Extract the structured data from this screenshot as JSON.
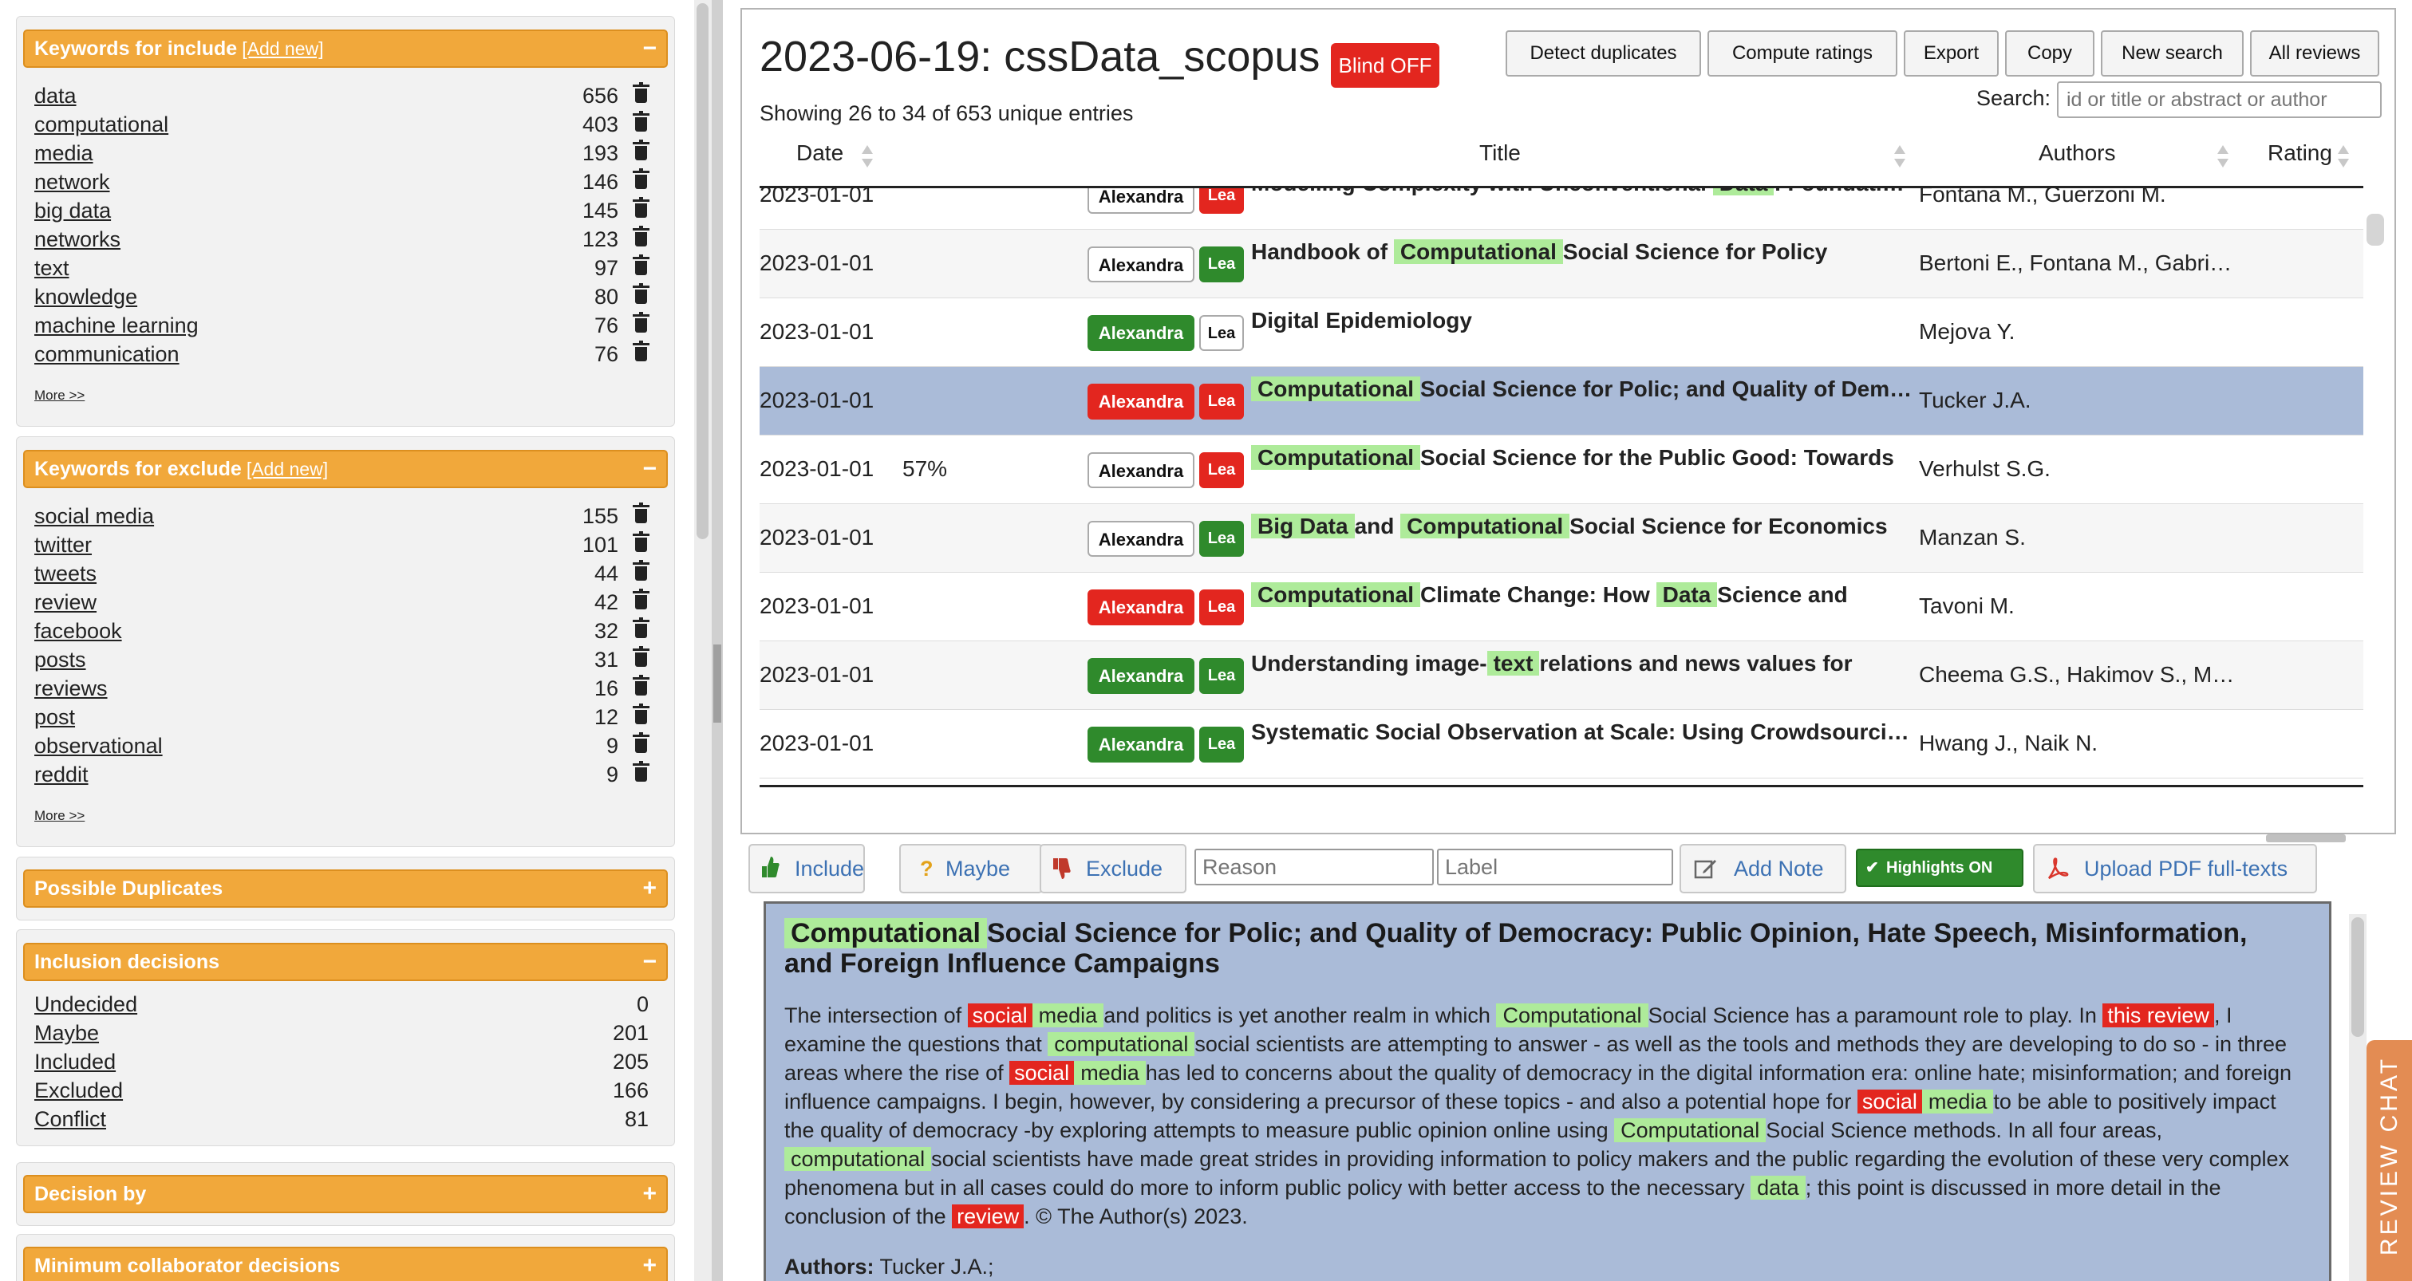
{
  "include_panel": {
    "title": "Keywords for include",
    "add_label": "[Add new]",
    "toggle": "−",
    "more": "More >>",
    "items": [
      {
        "k": "data",
        "n": "656"
      },
      {
        "k": "computational",
        "n": "403"
      },
      {
        "k": "media",
        "n": "193"
      },
      {
        "k": "network",
        "n": "146"
      },
      {
        "k": "big data",
        "n": "145"
      },
      {
        "k": "networks",
        "n": "123"
      },
      {
        "k": "text",
        "n": "97"
      },
      {
        "k": "knowledge",
        "n": "80"
      },
      {
        "k": "machine learning",
        "n": "76"
      },
      {
        "k": "communication",
        "n": "76"
      }
    ]
  },
  "exclude_panel": {
    "title": "Keywords for exclude",
    "add_label": "[Add new]",
    "toggle": "−",
    "more": "More >>",
    "items": [
      {
        "k": "social media",
        "n": "155"
      },
      {
        "k": "twitter",
        "n": "101"
      },
      {
        "k": "tweets",
        "n": "44"
      },
      {
        "k": "review",
        "n": "42"
      },
      {
        "k": "facebook",
        "n": "32"
      },
      {
        "k": "posts",
        "n": "31"
      },
      {
        "k": "reviews",
        "n": "16"
      },
      {
        "k": "post",
        "n": "12"
      },
      {
        "k": "observational",
        "n": "9"
      },
      {
        "k": "reddit",
        "n": "9"
      }
    ]
  },
  "duplicates_panel": {
    "title": "Possible Duplicates",
    "toggle": "+"
  },
  "decisions_panel": {
    "title": "Inclusion decisions",
    "toggle": "−",
    "items": [
      {
        "k": "Undecided",
        "n": "0"
      },
      {
        "k": "Maybe",
        "n": "201"
      },
      {
        "k": "Included",
        "n": "205"
      },
      {
        "k": "Excluded",
        "n": "166"
      },
      {
        "k": "Conflict",
        "n": "81"
      }
    ]
  },
  "decision_by_panel": {
    "title": "Decision by",
    "toggle": "+"
  },
  "min_collab_panel": {
    "title": "Minimum collaborator decisions",
    "toggle": "+"
  },
  "header": {
    "title": "2023-06-19: cssData_scopus",
    "blind": "Blind OFF",
    "showing": "Showing 26 to 34 of 653 unique entries",
    "search_label": "Search:",
    "search_placeholder": "id or title or abstract or author"
  },
  "toolbar": [
    "Detect duplicates",
    "Compute ratings",
    "Export",
    "Copy",
    "New search",
    "All reviews"
  ],
  "columns": {
    "date": "Date",
    "title": "Title",
    "authors": "Authors",
    "rating": "Rating"
  },
  "rows": [
    {
      "date": "2023-01-01",
      "pct": "",
      "r1": "Alexandra",
      "r1s": "w",
      "r2": "Lea",
      "r2s": "r",
      "title": [
        [
          "",
          "Modelling Complexity with Unconventional "
        ],
        [
          "g",
          "Data"
        ],
        [
          "",
          ": Foundations and Methods"
        ]
      ],
      "authors": "Fontana M., Guerzoni M."
    },
    {
      "date": "2023-01-01",
      "pct": "",
      "r1": "Alexandra",
      "r1s": "w",
      "r2": "Lea",
      "r2s": "g",
      "title": [
        [
          "",
          "Handbook of "
        ],
        [
          "g",
          "Computational"
        ],
        [
          "",
          "Social Science for Policy"
        ]
      ],
      "authors": "Bertoni E., Fontana M., Gabri…"
    },
    {
      "date": "2023-01-01",
      "pct": "",
      "r1": "Alexandra",
      "r1s": "g",
      "r2": "Lea",
      "r2s": "w",
      "title": [
        [
          "",
          "Digital Epidemiology"
        ]
      ],
      "authors": "Mejova Y."
    },
    {
      "date": "2023-01-01",
      "pct": "",
      "r1": "Alexandra",
      "r1s": "r",
      "r2": "Lea",
      "r2s": "r",
      "title": [
        [
          "g",
          "Computational"
        ],
        [
          "",
          "Social Science for Polic; and Quality of Democracy"
        ]
      ],
      "authors": "Tucker J.A.",
      "selected": true
    },
    {
      "date": "2023-01-01",
      "pct": "57%",
      "r1": "Alexandra",
      "r1s": "w",
      "r2": "Lea",
      "r2s": "r",
      "title": [
        [
          "g",
          "Computational"
        ],
        [
          "",
          "Social Science for the Public Good: Towards"
        ]
      ],
      "authors": "Verhulst S.G."
    },
    {
      "date": "2023-01-01",
      "pct": "",
      "r1": "Alexandra",
      "r1s": "w",
      "r2": "Lea",
      "r2s": "g",
      "title": [
        [
          "g",
          "Big Data"
        ],
        [
          "",
          "and "
        ],
        [
          "g",
          "Computational"
        ],
        [
          "",
          "Social Science for Economics"
        ]
      ],
      "authors": "Manzan S."
    },
    {
      "date": "2023-01-01",
      "pct": "",
      "r1": "Alexandra",
      "r1s": "r",
      "r2": "Lea",
      "r2s": "r",
      "title": [
        [
          "g",
          "Computational"
        ],
        [
          "",
          "Climate Change: How "
        ],
        [
          "g",
          "Data"
        ],
        [
          "",
          "Science and"
        ]
      ],
      "authors": "Tavoni M."
    },
    {
      "date": "2023-01-01",
      "pct": "",
      "r1": "Alexandra",
      "r1s": "g",
      "r2": "Lea",
      "r2s": "g",
      "title": [
        [
          "",
          "Understanding image-"
        ],
        [
          "g",
          "text"
        ],
        [
          "",
          "relations and news values for"
        ]
      ],
      "authors": "Cheema G.S., Hakimov S., M…"
    },
    {
      "date": "2023-01-01",
      "pct": "",
      "r1": "Alexandra",
      "r1s": "g",
      "r2": "Lea",
      "r2s": "g",
      "title": [
        [
          "",
          "Systematic Social Observation at Scale: Using Crowdsourcing"
        ]
      ],
      "authors": "Hwang J., Naik N."
    }
  ],
  "actions": {
    "include": "Include",
    "maybe": "Maybe",
    "exclude": "Exclude",
    "reason_ph": "Reason",
    "label_ph": "Label",
    "add_note": "Add Note",
    "highlights": "Highlights ON",
    "upload": "Upload PDF full-texts"
  },
  "detail": {
    "title": [
      [
        "g",
        "Computational"
      ],
      [
        "",
        "Social Science for Polic; and Quality of Democracy: Public Opinion, Hate Speech, Misinformation, and Foreign Influence Campaigns"
      ]
    ],
    "abstract": [
      [
        "",
        "The intersection of "
      ],
      [
        "r",
        "social"
      ],
      [
        "g",
        "media"
      ],
      [
        "",
        "and politics is yet another realm in which "
      ],
      [
        "g",
        "Computational"
      ],
      [
        "",
        "Social Science has a paramount role to play. In "
      ],
      [
        "r",
        "this review"
      ],
      [
        "",
        ", I examine the questions that "
      ],
      [
        "g",
        "computational"
      ],
      [
        "",
        "social scientists are attempting to answer - as well as the tools and methods they are developing to do so - in three areas where the rise of "
      ],
      [
        "r",
        "social"
      ],
      [
        "g",
        "media"
      ],
      [
        "",
        "has led to concerns about the quality of democracy in the digital information era: online hate; misinformation; and foreign influence campaigns. I begin, however, by considering a precursor of these topics - and also a potential hope for "
      ],
      [
        "r",
        "social"
      ],
      [
        "g",
        "media"
      ],
      [
        "",
        "to be able to positively impact the quality of democracy -by exploring attempts to measure public opinion online using "
      ],
      [
        "g",
        "Computational"
      ],
      [
        "",
        "Social Science methods. In all four areas, "
      ],
      [
        "g",
        "computational"
      ],
      [
        "",
        "social scientists have made great strides in providing information to policy makers and the public regarding the evolution of these very complex phenomena but in all cases could do more to inform public policy with better access to the necessary "
      ],
      [
        "g",
        "data"
      ],
      [
        "",
        "; this point is discussed in more detail in the conclusion of the "
      ],
      [
        "r",
        "review"
      ],
      [
        "",
        ". © The Author(s) 2023."
      ]
    ],
    "authors_label": "Authors:",
    "authors": "Tucker J.A.;"
  },
  "review_chat": "REVIEW CHAT",
  "colors": {
    "accent": "#f1a83b",
    "green": "#2f8a2c",
    "red": "#e3261f",
    "selected_row": "#aabbd8",
    "highlight": "#aeeb9a",
    "chat": "#e38c53"
  }
}
